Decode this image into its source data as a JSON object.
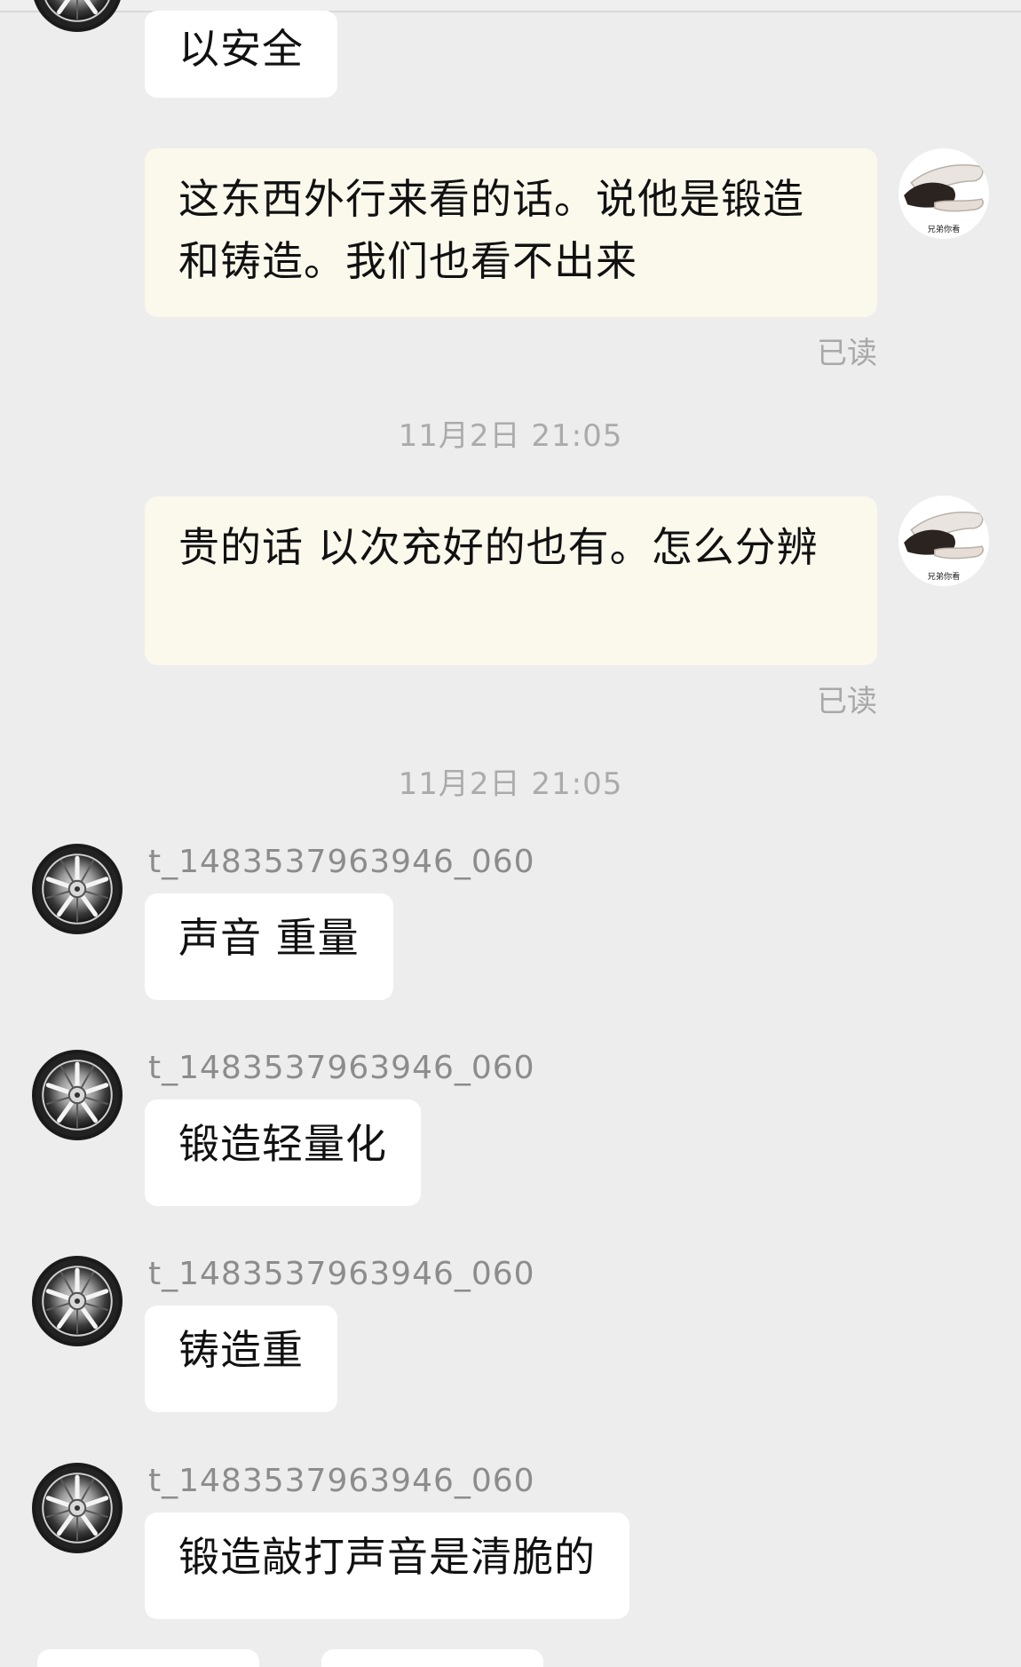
{
  "messages": {
    "m0_text": "以安全",
    "m1_text": "这东西外行来看的话。说他是锻造和铸造。我们也看不出来",
    "m1_status": "已读",
    "t1": "11月2日 21:05",
    "m2_text": "贵的话 以次充好的也有。怎么分辨",
    "m2_status": "已读",
    "t2": "11月2日 21:05",
    "m3_sender": "t_1483537963946_060",
    "m3_text": "声音 重量",
    "m4_sender": "t_1483537963946_060",
    "m4_text": "锻造轻量化",
    "m5_sender": "t_1483537963946_060",
    "m5_text": "铸造重",
    "m6_sender": "t_1483537963946_060",
    "m6_text": "锻造敲打声音是清脆的"
  },
  "avatars": {
    "self_caption": "兄弟你看",
    "self_icon": "hands-avatar-icon",
    "other_icon": "wheel-rim-avatar-icon"
  },
  "colors": {
    "background": "#ededed",
    "incoming_bubble": "#ffffff",
    "outgoing_bubble": "#fbf8ec",
    "meta_text": "#a8a8a8"
  }
}
